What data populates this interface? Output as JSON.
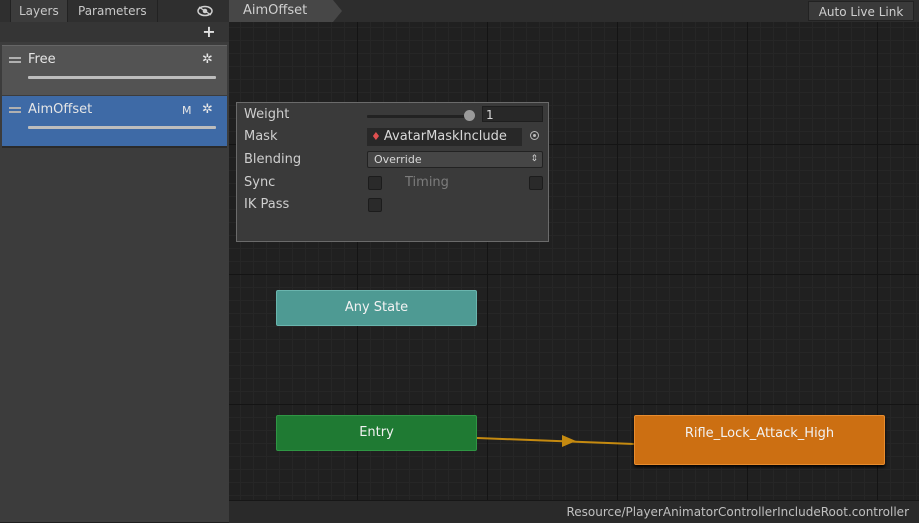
{
  "left_panel": {
    "tabs": [
      {
        "label": "Layers"
      },
      {
        "label": "Parameters"
      }
    ],
    "add_label": "+",
    "layers": [
      {
        "name": "Free",
        "selected": false,
        "weight": 1
      },
      {
        "name": "AimOffset",
        "badge": "M",
        "selected": true,
        "weight": 1
      }
    ]
  },
  "toolbar": {
    "breadcrumb": "AimOffset",
    "auto_live_link": "Auto Live Link"
  },
  "layer_settings": {
    "weight_label": "Weight",
    "weight_value": "1",
    "mask_label": "Mask",
    "mask_value": "AvatarMaskInclude",
    "blending_label": "Blending",
    "blending_value": "Override",
    "sync_label": "Sync",
    "timing_label": "Timing",
    "ik_pass_label": "IK Pass"
  },
  "states": {
    "any_state": "Any State",
    "entry": "Entry",
    "default_state": "Rifle_Lock_Attack_High"
  },
  "status": {
    "path": "Resource/PlayerAnimatorControllerIncludeRoot.controller"
  },
  "colors": {
    "selected_layer": "#3e6aa6",
    "any_state": "#4e9a93",
    "entry": "#1f7a33",
    "default_state": "#cc6f12",
    "transition": "#c58a10"
  }
}
